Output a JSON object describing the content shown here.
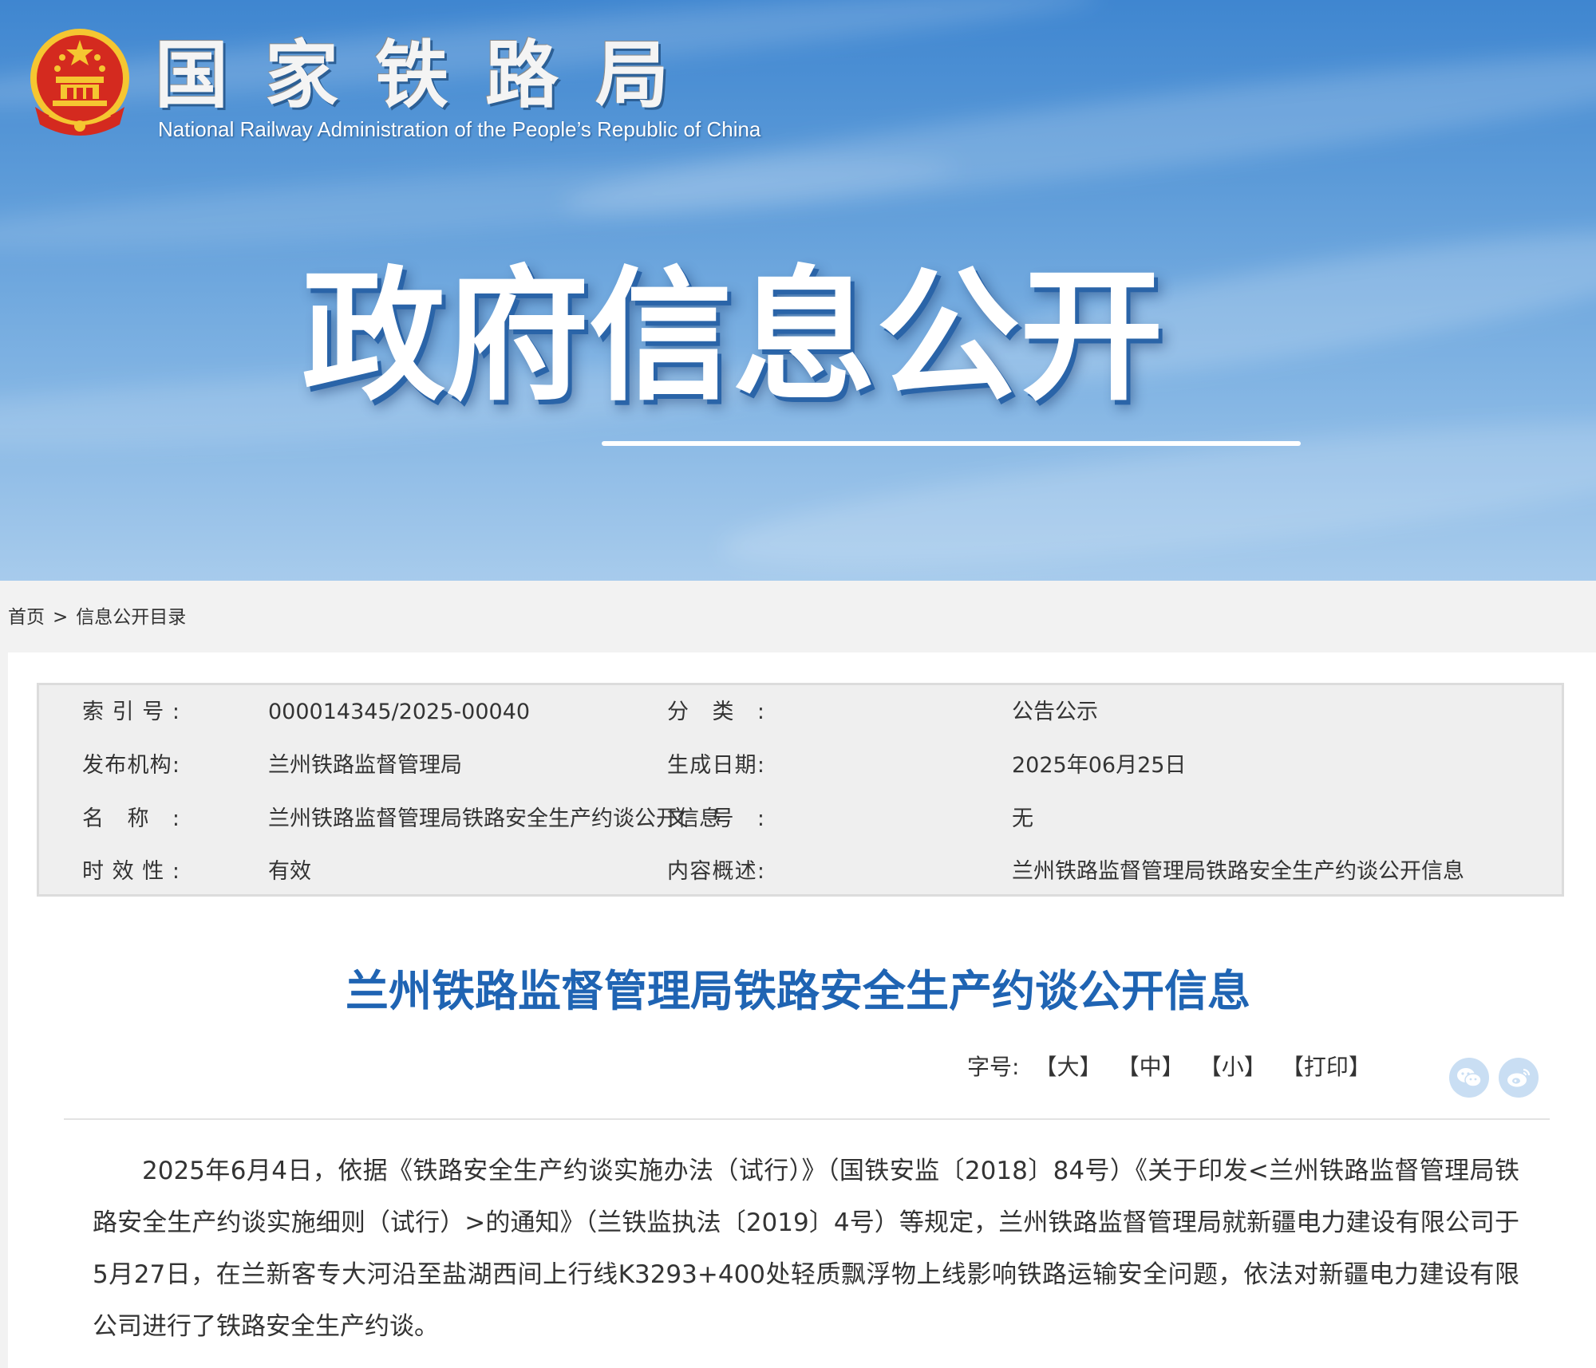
{
  "header": {
    "site_name_cn": "国家铁路局",
    "site_name_en": "National Railway Administration of the People’s Republic of China",
    "section_title": "政府信息公开"
  },
  "breadcrumb": {
    "home": "首页",
    "separator": ">",
    "current": "信息公开目录"
  },
  "meta": [
    {
      "label": "索引号:",
      "value": "000014345/2025-00040",
      "label2": "分类:",
      "value2": "公告公示"
    },
    {
      "label": "发布机构:",
      "value": "兰州铁路监督管理局",
      "label2": "生成日期:",
      "value2": "2025年06月25日"
    },
    {
      "label": "名称:",
      "value": "兰州铁路监督管理局铁路安全生产约谈公开信息",
      "label2": "文号:",
      "value2": "无"
    },
    {
      "label": "时效性:",
      "value": "有效",
      "label2": "内容概述:",
      "value2": "兰州铁路监督管理局铁路安全生产约谈公开信息"
    }
  ],
  "article": {
    "title": "兰州铁路监督管理局铁路安全生产约谈公开信息",
    "font_size_label": "字号:",
    "btn_large": "【大】",
    "btn_medium": "【中】",
    "btn_small": "【小】",
    "btn_print": "【打印】",
    "body": "2025年6月4日，依据《铁路安全生产约谈实施办法（试行）》（国铁安监〔2018〕84号）《关于印发<兰州铁路监督管理局铁路安全生产约谈实施细则（试行）>的通知》（兰铁监执法〔2019〕4号）等规定，兰州铁路监督管理局就新疆电力建设有限公司于5月27日，在兰新客专大河沿至盐湖西间上行线K3293+400处轻质飘浮物上线影响铁路运输安全问题，依法对新疆电力建设有限公司进行了铁路安全生产约谈。"
  },
  "share": {
    "icons": [
      "wechat-icon",
      "weibo-icon"
    ]
  },
  "colors": {
    "title_blue": "#1f64b3",
    "emblem_red": "#d42a1f",
    "emblem_gold": "#f5c631",
    "share_bg": "#c9def3"
  }
}
